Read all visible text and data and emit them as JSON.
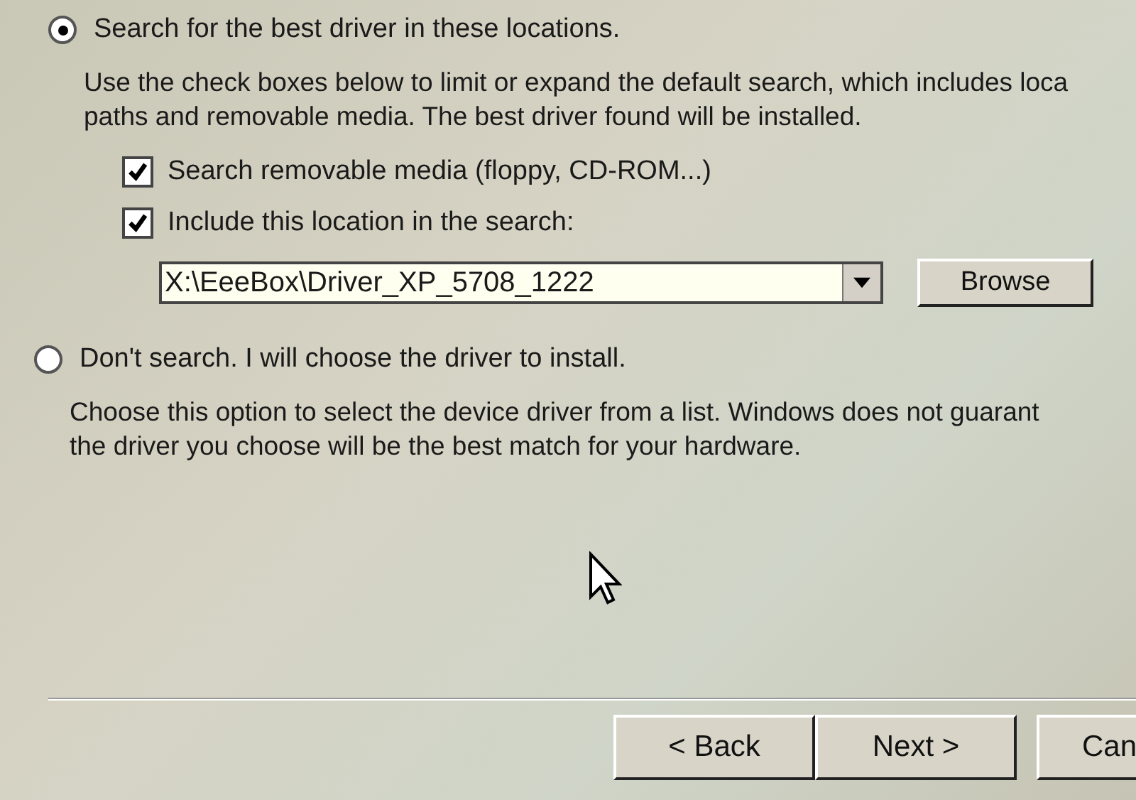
{
  "options": [
    {
      "label": "Search for the best driver in these locations.",
      "selected": true,
      "description": [
        "Use the check boxes below to limit or expand the default search, which includes loca",
        "paths and removable media. The best driver found will be installed."
      ],
      "checkboxes": [
        {
          "label": "Search removable media (floppy, CD-ROM...)",
          "checked": true
        },
        {
          "label": "Include this location in the search:",
          "checked": true
        }
      ],
      "location": {
        "value": "X:\\EeeBox\\Driver_XP_5708_1222",
        "button": "Browse"
      }
    },
    {
      "label": "Don't search. I will choose the driver to install.",
      "selected": false,
      "description": [
        "Choose this option to select the device driver from a list.  Windows does not guarant",
        "the driver you choose will be the best match for your hardware."
      ]
    }
  ],
  "buttons": [
    "< Back",
    "Next >",
    "Can"
  ]
}
